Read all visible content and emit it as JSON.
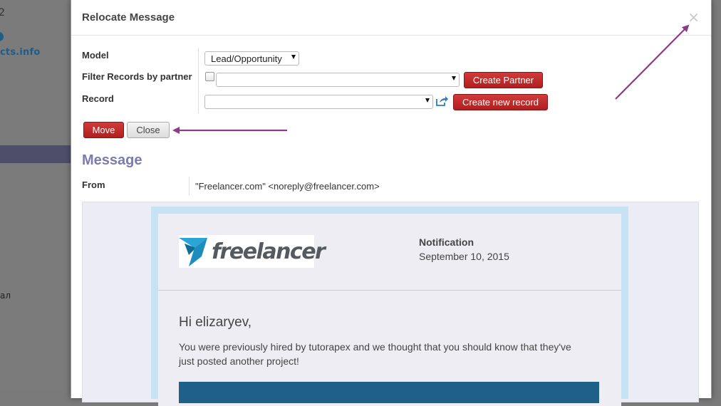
{
  "background": {
    "logo_text": "cts.info",
    "side_text": "ал"
  },
  "dialog": {
    "title": "Relocate Message",
    "close_glyph": "×"
  },
  "form": {
    "model_label": "Model",
    "model_value": "Lead/Opportunity",
    "filter_label": "Filter Records by partner",
    "filter_checked": false,
    "partner_value": "",
    "create_partner_label": "Create Partner",
    "record_label": "Record",
    "record_value": "",
    "create_record_label": "Create new record"
  },
  "actions": {
    "move_label": "Move",
    "close_label": "Close"
  },
  "message": {
    "section_title": "Message",
    "from_label": "From",
    "from_value": "\"Freelancer.com\" <noreply@freelancer.com>"
  },
  "email": {
    "logo_text": "freelancer",
    "notification_title": "Notification",
    "notification_date": "September 10, 2015",
    "greeting": "Hi elizaryev,",
    "body": "You were previously hired by tutorapex and we thought that you should know that they've just posted another project!"
  },
  "colors": {
    "primary_red": "#c0282b",
    "section_title": "#7c7bad",
    "annotation_arrow": "#8e3b86",
    "email_frame": "#c5e3f3",
    "email_banner": "#1f6088"
  }
}
